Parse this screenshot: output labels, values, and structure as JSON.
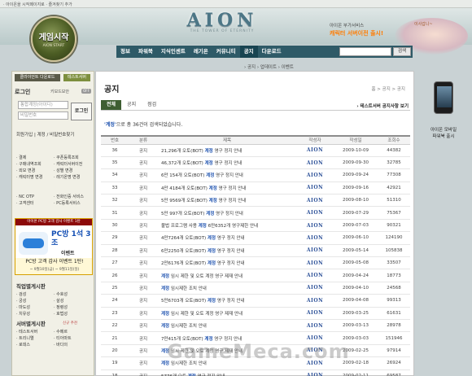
{
  "topbar": {
    "links": "· 아이온을 시작페이지로   · 즐겨찾기 추가"
  },
  "header": {
    "logo": "AION",
    "logo_sub": "THE TOWER OF ETERNITY",
    "promo_line1": "아이온 부가서비스",
    "promo_line2": "캐릭터 서버이전 출시!",
    "mascot_caption": "이사갑니~"
  },
  "start": {
    "title": "게임시작",
    "sub": "AION START"
  },
  "nav": {
    "items": [
      "정보",
      "파워북",
      "지식인센트",
      "레기온",
      "커뮤니티",
      "공지",
      "다운로드"
    ],
    "active_index": 5,
    "search_button": "검색"
  },
  "breadcrumb_top": "› 공지  › 업데이트  › 이벤트",
  "sidebar": {
    "client_download": "클라이언트 다운로드",
    "test_server": "테스트서버",
    "login_title": "로그인",
    "keyboard_security": "키보드보안",
    "off": "OFF",
    "id_placeholder": "통합계정(아이디)",
    "pw_placeholder": "비밀번호",
    "login_button": "로그인",
    "links": "회원가입  |  계정 / 비밀번호찾기",
    "menu": [
      [
        "· 결제",
        "· 쿠폰등록조회"
      ],
      [
        "· 구매내역조회",
        "· 캐릭터서버이전"
      ],
      [
        "· 외모 변경",
        "· 성별 변경"
      ],
      [
        "· 캐릭터명 변경",
        "· 레기온명 변경"
      ]
    ],
    "menu2": [
      [
        "· NC OTP",
        "· 전화인증 서비스"
      ],
      [
        "· 고객센터",
        "· PC등록서비스"
      ]
    ],
    "pc_header": "아이온 PC방 고객 감사 이벤트 1탄",
    "pc_big": "PC방 1석 3조",
    "pc_event": "이벤트",
    "pc_foot": "PC방 고객 감사 이벤트 1탄!",
    "pc_date": "~ 9월10일(금) ~ 9월11일(일)",
    "job_title": "직업별게시판",
    "jobs": [
      [
        "· 검성",
        "· 수호성"
      ],
      [
        "· 궁성",
        "· 살성"
      ],
      [
        "· 마도성",
        "· 정령성"
      ],
      [
        "· 치유성",
        "· 호법성"
      ]
    ],
    "server_title": "서버별게시판",
    "server_badges": "신규 추천",
    "servers": [
      [
        "· 테스트서버",
        "· 수메르"
      ],
      [
        "· 트리니엘",
        "· 티아마트"
      ],
      [
        "· 로데스",
        "· 바다의"
      ]
    ]
  },
  "content": {
    "title": "공지",
    "crumb": "홈  >  공지  >  공지",
    "tabs": [
      "전체",
      "공지",
      "점검"
    ],
    "active_tab": 0,
    "test_server_link": "› 테스트서버 공지사항 보기",
    "result_keyword": "'계정'",
    "result_text": "으로 총 36건이 검색되었습니다.",
    "columns": [
      "번호",
      "분류",
      "제목",
      "작성자",
      "작성일",
      "조회수"
    ],
    "rows": [
      {
        "no": "36",
        "cat": "공지",
        "pre": "21,296개 오토(BOT) ",
        "kw": "계정",
        "post": " 영구 정지 안내",
        "writer": "AION",
        "date": "2009-10-09",
        "views": "44382"
      },
      {
        "no": "35",
        "cat": "공지",
        "pre": "46,372개 오토(BOT) ",
        "kw": "계정",
        "post": " 영구 정지 안내",
        "writer": "AION",
        "date": "2009-09-30",
        "views": "32785"
      },
      {
        "no": "34",
        "cat": "공지",
        "pre": "6만 154개 오토(BOT) ",
        "kw": "계정",
        "post": " 영구 정지 안내",
        "writer": "AION",
        "date": "2009-09-24",
        "views": "77308"
      },
      {
        "no": "33",
        "cat": "공지",
        "pre": "4만 4184개 오토(BOT) ",
        "kw": "계정",
        "post": " 영구 정지 안내",
        "writer": "AION",
        "date": "2009-09-16",
        "views": "42921"
      },
      {
        "no": "32",
        "cat": "공지",
        "pre": "5만 9569개 오토(BOT) ",
        "kw": "계정",
        "post": " 영구 정지 안내",
        "writer": "AION",
        "date": "2009-08-10",
        "views": "51310"
      },
      {
        "no": "31",
        "cat": "공지",
        "pre": "5만 997개 오토(BOT) ",
        "kw": "계정",
        "post": " 영구 정지 안내",
        "writer": "AION",
        "date": "2009-07-29",
        "views": "75367"
      },
      {
        "no": "30",
        "cat": "공지",
        "pre": "불법 프로그램 사용 ",
        "kw": "계정",
        "post": " 6만6352개 영구제한 안내",
        "writer": "AION",
        "date": "2009-07-03",
        "views": "90321"
      },
      {
        "no": "29",
        "cat": "공지",
        "pre": "4만7264개 오토(BOT) ",
        "kw": "계정",
        "post": " 영구 정지 안내",
        "writer": "AION",
        "date": "2009-06-10",
        "views": "124190"
      },
      {
        "no": "28",
        "cat": "공지",
        "pre": "6만2250개 오토(BOT) ",
        "kw": "계정",
        "post": " 영구 정지 안내",
        "writer": "AION",
        "date": "2009-05-14",
        "views": "105838"
      },
      {
        "no": "27",
        "cat": "공지",
        "pre": "2만6176개 오토(BOT) ",
        "kw": "계정",
        "post": " 영구 정지 안내",
        "writer": "AION",
        "date": "2009-05-08",
        "views": "33507"
      },
      {
        "no": "26",
        "cat": "공지",
        "pre": "",
        "kw": "계정",
        "post": " 임시 제한 및 오토 계정 영구 제재 안내",
        "writer": "AION",
        "date": "2009-04-24",
        "views": "18773"
      },
      {
        "no": "25",
        "cat": "공지",
        "pre": "",
        "kw": "계정",
        "post": " 임시제한 조치 안내",
        "writer": "AION",
        "date": "2009-04-10",
        "views": "24568"
      },
      {
        "no": "24",
        "cat": "공지",
        "pre": "5만6703개 오토(BOT) ",
        "kw": "계정",
        "post": " 영구 정지 안내",
        "writer": "AION",
        "date": "2009-04-08",
        "views": "99313"
      },
      {
        "no": "23",
        "cat": "공지",
        "pre": "",
        "kw": "계정",
        "post": " 임시 제한 및 오토 계정 영구 제재 안내",
        "writer": "AION",
        "date": "2009-03-25",
        "views": "61631"
      },
      {
        "no": "22",
        "cat": "공지",
        "pre": "",
        "kw": "계정",
        "post": " 임시제한 조치 안내",
        "writer": "AION",
        "date": "2009-03-13",
        "views": "28978"
      },
      {
        "no": "21",
        "cat": "공지",
        "pre": "7만415개 오토(BOT) ",
        "kw": "계정",
        "post": " 영구 정지 안내",
        "writer": "AION",
        "date": "2009-03-03",
        "views": "151946"
      },
      {
        "no": "20",
        "cat": "공지",
        "pre": "",
        "kw": "계정",
        "post": " 임시 제한 및 오토 계정 영구 제재 안내",
        "writer": "AION",
        "date": "2009-02-25",
        "views": "97914"
      },
      {
        "no": "19",
        "cat": "공지",
        "pre": "",
        "kw": "계정",
        "post": " 임시제한 조치 안내",
        "writer": "AION",
        "date": "2009-02-18",
        "views": "26924"
      },
      {
        "no": "18",
        "cat": "공지",
        "pre": "5776개 오토 ",
        "kw": "계정",
        "post": " 영구 정지 안내",
        "writer": "AION",
        "date": "2009-02-11",
        "views": "69587"
      }
    ]
  },
  "mobile": {
    "line1": "아이온 모바일",
    "line2": "파워북 출시"
  },
  "watermark": "GameMeca.com"
}
